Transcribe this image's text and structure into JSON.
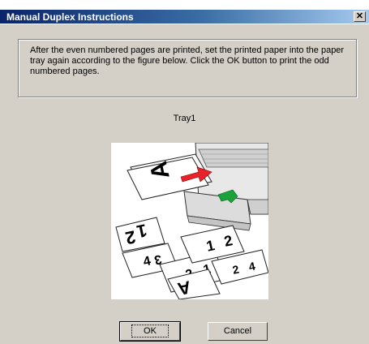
{
  "window": {
    "title": "Manual Duplex Instructions",
    "close_glyph": "✕"
  },
  "instructions": "After the even numbered pages are printed, set the printed paper into the paper tray again according to the figure below. Click the OK button to print the odd numbered pages.",
  "tray_label": "Tray1",
  "figure": {
    "page_letters": [
      "A",
      "1",
      "2",
      "3",
      "4"
    ],
    "arrow_colors": {
      "red": "#e8222a",
      "green": "#1aa33a"
    }
  },
  "buttons": {
    "ok": "OK",
    "cancel": "Cancel"
  }
}
